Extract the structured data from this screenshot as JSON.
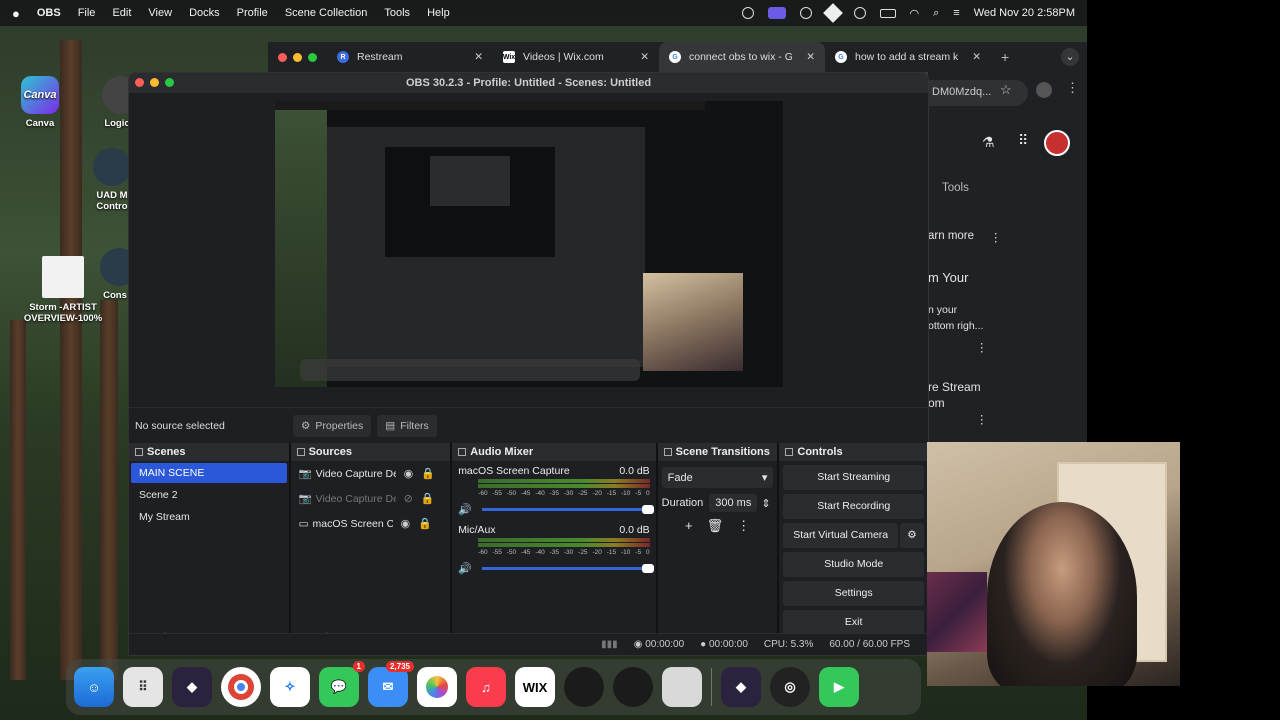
{
  "menubar": {
    "apple": "",
    "app_name": "OBS",
    "items": [
      "File",
      "Edit",
      "View",
      "Docks",
      "Profile",
      "Scene Collection",
      "Tools",
      "Help"
    ],
    "clock": "Wed Nov 20  2:58PM"
  },
  "chrome": {
    "tabs": [
      {
        "label": "Restream",
        "icon_text": "R",
        "icon_color": "#3d6ce0"
      },
      {
        "label": "Videos | Wix.com",
        "icon_text": "Wix",
        "icon_color": "#fff"
      },
      {
        "label": "connect obs to wix - Googl",
        "icon_text": "G",
        "icon_color": "#fff"
      },
      {
        "label": "how to add a stream key to",
        "icon_text": "G",
        "icon_color": "#fff"
      }
    ],
    "url_fragment": "DM0Mzdq...",
    "page_texts": [
      "Tools",
      "arn more",
      "m Your",
      "n your",
      "ottom righ...",
      "re Stream",
      "om"
    ]
  },
  "desktop": {
    "icons": [
      {
        "label": "Canva"
      },
      {
        "label": "Logic"
      },
      {
        "label": "UAD M Contro"
      },
      {
        "label": "Storm -ARTIST OVERVIEW-100%"
      },
      {
        "label": "Cons"
      }
    ]
  },
  "obs": {
    "title": "OBS 30.2.3 - Profile: Untitled - Scenes: Untitled",
    "no_source": "No source selected",
    "properties_label": "Properties",
    "filters_label": "Filters",
    "scenes": {
      "title": "Scenes",
      "items": [
        "MAIN SCENE",
        "Scene 2",
        "My Stream"
      ]
    },
    "sources": {
      "title": "Sources",
      "items": [
        "Video Capture Devi",
        "Video Capture Devi",
        "macOS Screen Cap"
      ]
    },
    "mixer": {
      "title": "Audio Mixer",
      "channels": [
        {
          "name": "macOS Screen Capture",
          "db": "0.0 dB",
          "level": 1.0
        },
        {
          "name": "Mic/Aux",
          "db": "0.0 dB",
          "level": 1.0
        }
      ],
      "ticks": [
        "-60",
        "-55",
        "-50",
        "-45",
        "-40",
        "-35",
        "-30",
        "-25",
        "-20",
        "-15",
        "-10",
        "-5",
        "0"
      ]
    },
    "transitions": {
      "title": "Scene Transitions",
      "selected": "Fade",
      "duration_label": "Duration",
      "duration_value": "300 ms"
    },
    "controls": {
      "title": "Controls",
      "buttons": [
        "Start Streaming",
        "Start Recording",
        "Start Virtual Camera",
        "Studio Mode",
        "Settings",
        "Exit"
      ]
    },
    "status": {
      "stream_time": "00:00:00",
      "rec_time": "00:00:00",
      "cpu": "CPU: 5.3%",
      "fps": "60.00 / 60.00 FPS"
    }
  },
  "dock": {
    "messages_badge": "1",
    "mail_badge": "2,735",
    "wix_label": "WIX"
  }
}
